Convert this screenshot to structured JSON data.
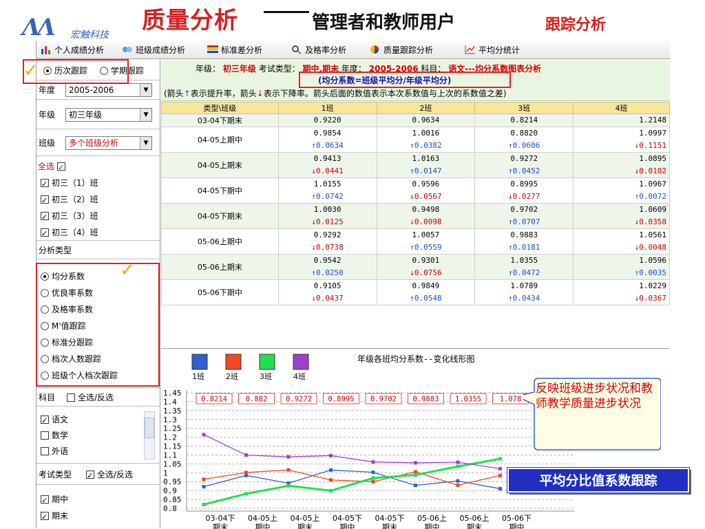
{
  "slide": {
    "logo_text": "宏触科技",
    "title_main": "质量分析",
    "title_sub": "管理者和教师用户",
    "title_tag": "跟踪分析"
  },
  "toolbar": {
    "items": [
      "个人成绩分析",
      "班级成绩分析",
      "标准差分析",
      "及格率分析",
      "质量跟踪分析",
      "平均分统计"
    ]
  },
  "sidebar": {
    "track_mode": {
      "option1": "历次跟踪",
      "option2": "学期跟踪",
      "selected": "历次跟踪"
    },
    "year_label": "年度",
    "year_value": "2005-2006",
    "grade_label": "年级",
    "grade_value": "初三年级",
    "class_label": "班级",
    "class_value": "多个班级分析",
    "select_all_label": "全选",
    "classes": [
      "初三（1）班",
      "初三（2）班",
      "初三（3）班",
      "初三（4）班"
    ],
    "analysis_type_label": "分析类型",
    "analysis_types": [
      "均分系数",
      "优良率系数",
      "及格率系数",
      "M'值跟踪",
      "标准分跟踪",
      "档次人数跟踪",
      "班级个人档次跟踪"
    ],
    "subject_label": "科目",
    "subject_toggle": "全选/反选",
    "subjects": [
      {
        "name": "语文",
        "checked": true
      },
      {
        "name": "数学",
        "checked": false
      },
      {
        "name": "外语",
        "checked": false
      }
    ],
    "exam_type_label": "考试类型",
    "exam_type_toggle": "全选/反选",
    "exam_types": [
      "期中",
      "期末"
    ]
  },
  "info": {
    "grade_prefix": "年级：",
    "grade": "初三年级",
    "exam_prefix": "考试类型：",
    "exam": "期中,期末",
    "year_prefix": "年度：",
    "year": "2005-2006",
    "subject_prefix": "科目：",
    "subject": "语文---均分系数图表分析",
    "formula": "(均分系数=班级平均分/年级平均分)",
    "note_a": "(箭头",
    "note_b": "表示提升率，箭头",
    "note_c": "表示下降率。箭头后面的数值表示本次系数值与上次的系数值之差)",
    "arrow_up": "↑",
    "arrow_down": "↓"
  },
  "table": {
    "headers": [
      "类型\\班级",
      "1班",
      "2班",
      "3班",
      "4班"
    ],
    "rows": [
      {
        "label": "03-04下期末",
        "cells": [
          {
            "v": "0.9220",
            "a": "",
            "d": ""
          },
          {
            "v": "0.9634",
            "a": "",
            "d": ""
          },
          {
            "v": "0.8214",
            "a": "",
            "d": ""
          },
          {
            "v": "1.2148",
            "a": "",
            "d": ""
          }
        ]
      },
      {
        "label": "04-05上期中",
        "cells": [
          {
            "v": "0.9854",
            "a": "↑",
            "d": "0.0634"
          },
          {
            "v": "1.0016",
            "a": "↑",
            "d": "0.0382"
          },
          {
            "v": "0.8820",
            "a": "↑",
            "d": "0.0606"
          },
          {
            "v": "1.0997",
            "a": "↓",
            "d": "0.1151"
          }
        ]
      },
      {
        "label": "04-05上期末",
        "cells": [
          {
            "v": "0.9413",
            "a": "↓",
            "d": "0.0441"
          },
          {
            "v": "1.0163",
            "a": "↑",
            "d": "0.0147"
          },
          {
            "v": "0.9272",
            "a": "↑",
            "d": "0.0452"
          },
          {
            "v": "1.0895",
            "a": "↓",
            "d": "0.0102"
          }
        ]
      },
      {
        "label": "04-05下期中",
        "cells": [
          {
            "v": "1.0155",
            "a": "↑",
            "d": "0.0742"
          },
          {
            "v": "0.9596",
            "a": "↓",
            "d": "0.0567"
          },
          {
            "v": "0.8995",
            "a": "↓",
            "d": "0.0277"
          },
          {
            "v": "1.0967",
            "a": "↑",
            "d": "0.0072"
          }
        ]
      },
      {
        "label": "04-05下期末",
        "cells": [
          {
            "v": "1.0030",
            "a": "↓",
            "d": "0.0125"
          },
          {
            "v": "0.9498",
            "a": "↓",
            "d": "0.0098"
          },
          {
            "v": "0.9702",
            "a": "↑",
            "d": "0.0707"
          },
          {
            "v": "1.0609",
            "a": "↓",
            "d": "0.0358"
          }
        ]
      },
      {
        "label": "05-06上期中",
        "cells": [
          {
            "v": "0.9292",
            "a": "↓",
            "d": "0.0738"
          },
          {
            "v": "1.0057",
            "a": "↑",
            "d": "0.0559"
          },
          {
            "v": "0.9883",
            "a": "↑",
            "d": "0.0181"
          },
          {
            "v": "1.0561",
            "a": "↓",
            "d": "0.0048"
          }
        ]
      },
      {
        "label": "05-06上期末",
        "cells": [
          {
            "v": "0.9542",
            "a": "↑",
            "d": "0.0250"
          },
          {
            "v": "0.9301",
            "a": "↓",
            "d": "0.0756"
          },
          {
            "v": "1.0355",
            "a": "↑",
            "d": "0.0472"
          },
          {
            "v": "1.0596",
            "a": "↑",
            "d": "0.0035"
          }
        ]
      },
      {
        "label": "05-06下期中",
        "cells": [
          {
            "v": "0.9105",
            "a": "↓",
            "d": "0.0437"
          },
          {
            "v": "0.9849",
            "a": "↑",
            "d": "0.0548"
          },
          {
            "v": "1.0789",
            "a": "↑",
            "d": "0.0434"
          },
          {
            "v": "1.0229",
            "a": "↓",
            "d": "0.0367"
          }
        ]
      }
    ]
  },
  "chart_data": {
    "type": "line",
    "title": "年级各班均分系数--变化线形图",
    "categories": [
      "03-04下\n期末",
      "04-05上\n期中",
      "04-05上\n期末",
      "04-05下\n期中",
      "04-05下\n期末",
      "05-06上\n期中",
      "05-06上\n期末",
      "05-06下\n期中"
    ],
    "ylim": [
      0.8,
      1.45
    ],
    "yticks": [
      "1.45",
      "1.4",
      "1.35",
      "1.3",
      "1.25",
      "1.2",
      "1.15",
      "1.1",
      "1.05",
      "1",
      "0.95",
      "0.9",
      "0.85",
      "0.8"
    ],
    "yticks_num": [
      1.45,
      1.4,
      1.35,
      1.3,
      1.25,
      1.2,
      1.15,
      1.1,
      1.05,
      1.0,
      0.95,
      0.9,
      0.85,
      0.8
    ],
    "data_labels": [
      "0.8214",
      "0.882",
      "0.9272",
      "0.8995",
      "0.9702",
      "0.9883",
      "1.0355",
      "1.078"
    ],
    "series": [
      {
        "name": "1班",
        "color": "#3060d0",
        "values": [
          0.922,
          0.9854,
          0.9413,
          1.0155,
          1.003,
          0.9292,
          0.9542,
          0.9105
        ]
      },
      {
        "name": "2班",
        "color": "#f04820",
        "values": [
          0.9634,
          1.0016,
          1.0163,
          0.9596,
          0.9498,
          1.0057,
          0.9301,
          0.9849
        ]
      },
      {
        "name": "3班",
        "color": "#20e050",
        "values": [
          0.8214,
          0.882,
          0.9272,
          0.8995,
          0.9702,
          0.9883,
          1.0355,
          1.0789
        ]
      },
      {
        "name": "4班",
        "color": "#a040d0",
        "values": [
          1.2148,
          1.0997,
          1.0895,
          1.0967,
          1.0609,
          1.0561,
          1.0596,
          1.0229
        ]
      }
    ]
  },
  "annotations": {
    "callout": "反映班级进步状况和教师教学质量进步状况",
    "summary": "平均分比值系数跟踪"
  },
  "colors": {
    "accent_red": "#d42020",
    "highlight_blue": "#1e2fc2"
  }
}
